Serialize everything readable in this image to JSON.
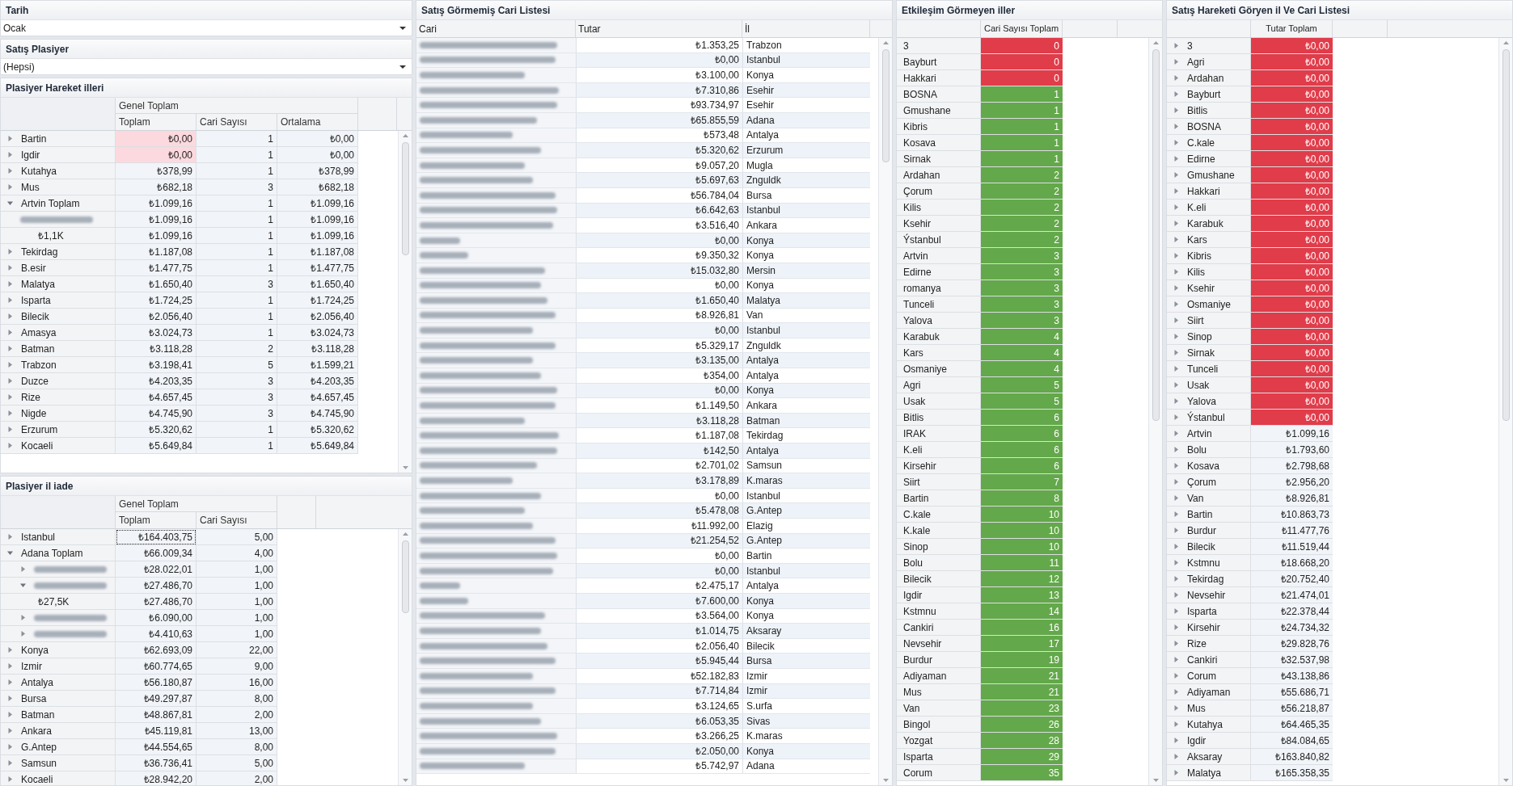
{
  "filters": [
    {
      "title": "Tarih",
      "value": "Ocak"
    },
    {
      "title": "Satış Plasiyer",
      "value": "(Hepsi)"
    }
  ],
  "hareket": {
    "title": "Plasiyer Hareket illeri",
    "group": "Genel Toplam",
    "columns": [
      "Toplam",
      "Cari Sayısı",
      "Ortalama"
    ],
    "rows": [
      {
        "label": "Bartin",
        "expanded": false,
        "flagged": true,
        "values": [
          "₺0,00",
          "1",
          "₺0,00"
        ]
      },
      {
        "label": "Igdir",
        "expanded": false,
        "flagged": true,
        "values": [
          "₺0,00",
          "1",
          "₺0,00"
        ]
      },
      {
        "label": "Kutahya",
        "expanded": false,
        "flagged": false,
        "values": [
          "₺378,99",
          "1",
          "₺378,99"
        ]
      },
      {
        "label": "Mus",
        "expanded": false,
        "flagged": false,
        "values": [
          "₺682,18",
          "3",
          "₺682,18"
        ]
      },
      {
        "label": "Artvin Toplam",
        "expanded": true,
        "flagged": false,
        "values": [
          "₺1.099,16",
          "1",
          "₺1.099,16"
        ],
        "children": [
          {
            "flagged": false,
            "values": [
              "₺1.099,16",
              "1",
              "₺1.099,16"
            ],
            "children": [
              {
                "label": "₺1,1K",
                "flagged": false,
                "values": [
                  "₺1.099,16",
                  "1",
                  "₺1.099,16"
                ]
              }
            ]
          }
        ]
      },
      {
        "label": "Tekirdag",
        "expanded": false,
        "flagged": false,
        "values": [
          "₺1.187,08",
          "1",
          "₺1.187,08"
        ]
      },
      {
        "label": "B.esir",
        "expanded": false,
        "flagged": false,
        "values": [
          "₺1.477,75",
          "1",
          "₺1.477,75"
        ]
      },
      {
        "label": "Malatya",
        "expanded": false,
        "flagged": false,
        "values": [
          "₺1.650,40",
          "3",
          "₺1.650,40"
        ]
      },
      {
        "label": "Isparta",
        "expanded": false,
        "flagged": false,
        "values": [
          "₺1.724,25",
          "1",
          "₺1.724,25"
        ]
      },
      {
        "label": "Bilecik",
        "expanded": false,
        "flagged": false,
        "values": [
          "₺2.056,40",
          "1",
          "₺2.056,40"
        ]
      },
      {
        "label": "Amasya",
        "expanded": false,
        "flagged": false,
        "values": [
          "₺3.024,73",
          "1",
          "₺3.024,73"
        ]
      },
      {
        "label": "Batman",
        "expanded": false,
        "flagged": false,
        "values": [
          "₺3.118,28",
          "2",
          "₺3.118,28"
        ]
      },
      {
        "label": "Trabzon",
        "expanded": false,
        "flagged": false,
        "values": [
          "₺3.198,41",
          "5",
          "₺1.599,21"
        ]
      },
      {
        "label": "Duzce",
        "expanded": false,
        "flagged": false,
        "values": [
          "₺4.203,35",
          "3",
          "₺4.203,35"
        ]
      },
      {
        "label": "Rize",
        "expanded": false,
        "flagged": false,
        "values": [
          "₺4.657,45",
          "3",
          "₺4.657,45"
        ]
      },
      {
        "label": "Nigde",
        "expanded": false,
        "flagged": false,
        "values": [
          "₺4.745,90",
          "3",
          "₺4.745,90"
        ]
      },
      {
        "label": "Erzurum",
        "expanded": false,
        "flagged": false,
        "values": [
          "₺5.320,62",
          "1",
          "₺5.320,62"
        ]
      },
      {
        "label": "Kocaeli",
        "expanded": false,
        "flagged": false,
        "values": [
          "₺5.649,84",
          "1",
          "₺5.649,84"
        ]
      }
    ]
  },
  "iade": {
    "title": "Plasiyer il iade",
    "group": "Genel Toplam",
    "columns": [
      "Toplam",
      "Cari Sayısı"
    ],
    "rows": [
      {
        "label": "Istanbul",
        "expanded": false,
        "focused": true,
        "values": [
          "₺164.403,75",
          "5,00"
        ]
      },
      {
        "label": "Adana Toplam",
        "expanded": true,
        "focused": false,
        "values": [
          "₺66.009,34",
          "4,00"
        ],
        "children": [
          {
            "expanded": false,
            "focused": false,
            "values": [
              "₺28.022,01",
              "1,00"
            ]
          },
          {
            "expanded": true,
            "focused": false,
            "values": [
              "₺27.486,70",
              "1,00"
            ],
            "children": [
              {
                "label": "₺27,5K",
                "focused": false,
                "values": [
                  "₺27.486,70",
                  "1,00"
                ]
              }
            ]
          },
          {
            "expanded": false,
            "focused": false,
            "values": [
              "₺6.090,00",
              "1,00"
            ]
          },
          {
            "expanded": false,
            "focused": false,
            "values": [
              "₺4.410,63",
              "1,00"
            ]
          }
        ]
      },
      {
        "label": "Konya",
        "expanded": false,
        "focused": false,
        "values": [
          "₺62.693,09",
          "22,00"
        ]
      },
      {
        "label": "Izmir",
        "expanded": false,
        "focused": false,
        "values": [
          "₺60.774,65",
          "9,00"
        ]
      },
      {
        "label": "Antalya",
        "expanded": false,
        "focused": false,
        "values": [
          "₺56.180,87",
          "16,00"
        ]
      },
      {
        "label": "Bursa",
        "expanded": false,
        "focused": false,
        "values": [
          "₺49.297,87",
          "8,00"
        ]
      },
      {
        "label": "Batman",
        "expanded": false,
        "focused": false,
        "values": [
          "₺48.867,81",
          "2,00"
        ]
      },
      {
        "label": "Ankara",
        "expanded": false,
        "focused": false,
        "values": [
          "₺45.119,81",
          "13,00"
        ]
      },
      {
        "label": "G.Antep",
        "expanded": false,
        "focused": false,
        "values": [
          "₺44.554,65",
          "8,00"
        ]
      },
      {
        "label": "Samsun",
        "expanded": false,
        "focused": false,
        "values": [
          "₺36.736,41",
          "5,00"
        ]
      },
      {
        "label": "Kocaeli",
        "expanded": false,
        "focused": false,
        "values": [
          "₺28.942,20",
          "2,00"
        ]
      }
    ]
  },
  "cari_list": {
    "title": "Satış Görmemiş Cari Listesi",
    "columns": [
      "Cari",
      "Tutar",
      "İl"
    ],
    "rows": [
      {
        "tutar": "₺1.353,25",
        "il": "Trabzon"
      },
      {
        "tutar": "₺0,00",
        "il": "Istanbul"
      },
      {
        "tutar": "₺3.100,00",
        "il": "Konya"
      },
      {
        "tutar": "₺7.310,86",
        "il": "Esehir"
      },
      {
        "tutar": "₺93.734,97",
        "il": "Esehir"
      },
      {
        "tutar": "₺65.855,59",
        "il": "Adana"
      },
      {
        "tutar": "₺573,48",
        "il": "Antalya"
      },
      {
        "tutar": "₺5.320,62",
        "il": "Erzurum"
      },
      {
        "tutar": "₺9.057,20",
        "il": "Mugla"
      },
      {
        "tutar": "₺5.697,63",
        "il": "Znguldk"
      },
      {
        "tutar": "₺56.784,04",
        "il": "Bursa"
      },
      {
        "tutar": "₺6.642,63",
        "il": "Istanbul"
      },
      {
        "tutar": "₺3.516,40",
        "il": "Ankara"
      },
      {
        "tutar": "₺0,00",
        "il": "Konya"
      },
      {
        "tutar": "₺9.350,32",
        "il": "Konya"
      },
      {
        "tutar": "₺15.032,80",
        "il": "Mersin"
      },
      {
        "tutar": "₺0,00",
        "il": "Konya"
      },
      {
        "tutar": "₺1.650,40",
        "il": "Malatya"
      },
      {
        "tutar": "₺8.926,81",
        "il": "Van"
      },
      {
        "tutar": "₺0,00",
        "il": "Istanbul"
      },
      {
        "tutar": "₺5.329,17",
        "il": "Znguldk"
      },
      {
        "tutar": "₺3.135,00",
        "il": "Antalya"
      },
      {
        "tutar": "₺354,00",
        "il": "Antalya"
      },
      {
        "tutar": "₺0,00",
        "il": "Konya"
      },
      {
        "tutar": "₺1.149,50",
        "il": "Ankara"
      },
      {
        "tutar": "₺3.118,28",
        "il": "Batman"
      },
      {
        "tutar": "₺1.187,08",
        "il": "Tekirdag"
      },
      {
        "tutar": "₺142,50",
        "il": "Antalya"
      },
      {
        "tutar": "₺2.701,02",
        "il": "Samsun"
      },
      {
        "tutar": "₺3.178,89",
        "il": "K.maras"
      },
      {
        "tutar": "₺0,00",
        "il": "Istanbul"
      },
      {
        "tutar": "₺5.478,08",
        "il": "G.Antep"
      },
      {
        "tutar": "₺11.992,00",
        "il": "Elazig"
      },
      {
        "tutar": "₺21.254,52",
        "il": "G.Antep"
      },
      {
        "tutar": "₺0,00",
        "il": "Bartin"
      },
      {
        "tutar": "₺0,00",
        "il": "Istanbul"
      },
      {
        "tutar": "₺2.475,17",
        "il": "Antalya"
      },
      {
        "tutar": "₺7.600,00",
        "il": "Konya"
      },
      {
        "tutar": "₺3.564,00",
        "il": "Konya"
      },
      {
        "tutar": "₺1.014,75",
        "il": "Aksaray"
      },
      {
        "tutar": "₺2.056,40",
        "il": "Bilecik"
      },
      {
        "tutar": "₺5.945,44",
        "il": "Bursa"
      },
      {
        "tutar": "₺52.182,83",
        "il": "Izmir"
      },
      {
        "tutar": "₺7.714,84",
        "il": "Izmir"
      },
      {
        "tutar": "₺3.124,65",
        "il": "S.urfa"
      },
      {
        "tutar": "₺6.053,35",
        "il": "Sivas"
      },
      {
        "tutar": "₺3.266,25",
        "il": "K.maras"
      },
      {
        "tutar": "₺2.050,00",
        "il": "Konya"
      },
      {
        "tutar": "₺5.742,97",
        "il": "Adana"
      }
    ]
  },
  "etkilesim": {
    "title": "Etkileşim Görmeyen iller",
    "column": "Cari Sayısı Toplam",
    "rows": [
      {
        "label": "3",
        "value": "0",
        "color": "#e03c4a"
      },
      {
        "label": "Bayburt",
        "value": "0",
        "color": "#e03c4a"
      },
      {
        "label": "Hakkari",
        "value": "0",
        "color": "#e03c4a"
      },
      {
        "label": "BOSNA",
        "value": "1",
        "color": "#63a84a"
      },
      {
        "label": "Gmushane",
        "value": "1",
        "color": "#63a84a"
      },
      {
        "label": "Kibris",
        "value": "1",
        "color": "#63a84a"
      },
      {
        "label": "Kosava",
        "value": "1",
        "color": "#63a84a"
      },
      {
        "label": "Sirnak",
        "value": "1",
        "color": "#63a84a"
      },
      {
        "label": "Ardahan",
        "value": "2",
        "color": "#63a84a"
      },
      {
        "label": "Çorum",
        "value": "2",
        "color": "#63a84a"
      },
      {
        "label": "Kilis",
        "value": "2",
        "color": "#63a84a"
      },
      {
        "label": "Ksehir",
        "value": "2",
        "color": "#63a84a"
      },
      {
        "label": "Ýstanbul",
        "value": "2",
        "color": "#63a84a"
      },
      {
        "label": "Artvin",
        "value": "3",
        "color": "#63a84a"
      },
      {
        "label": "Edirne",
        "value": "3",
        "color": "#63a84a"
      },
      {
        "label": "romanya",
        "value": "3",
        "color": "#63a84a"
      },
      {
        "label": "Tunceli",
        "value": "3",
        "color": "#63a84a"
      },
      {
        "label": "Yalova",
        "value": "3",
        "color": "#63a84a"
      },
      {
        "label": "Karabuk",
        "value": "4",
        "color": "#63a84a"
      },
      {
        "label": "Kars",
        "value": "4",
        "color": "#63a84a"
      },
      {
        "label": "Osmaniye",
        "value": "4",
        "color": "#63a84a"
      },
      {
        "label": "Agri",
        "value": "5",
        "color": "#63a84a"
      },
      {
        "label": "Usak",
        "value": "5",
        "color": "#63a84a"
      },
      {
        "label": "Bitlis",
        "value": "6",
        "color": "#63a84a"
      },
      {
        "label": "IRAK",
        "value": "6",
        "color": "#63a84a"
      },
      {
        "label": "K.eli",
        "value": "6",
        "color": "#63a84a"
      },
      {
        "label": "Kirsehir",
        "value": "6",
        "color": "#63a84a"
      },
      {
        "label": "Siirt",
        "value": "7",
        "color": "#63a84a"
      },
      {
        "label": "Bartin",
        "value": "8",
        "color": "#63a84a"
      },
      {
        "label": "C.kale",
        "value": "10",
        "color": "#63a84a"
      },
      {
        "label": "K.kale",
        "value": "10",
        "color": "#63a84a"
      },
      {
        "label": "Sinop",
        "value": "10",
        "color": "#63a84a"
      },
      {
        "label": "Bolu",
        "value": "11",
        "color": "#63a84a"
      },
      {
        "label": "Bilecik",
        "value": "12",
        "color": "#63a84a"
      },
      {
        "label": "Igdir",
        "value": "13",
        "color": "#63a84a"
      },
      {
        "label": "Kstmnu",
        "value": "14",
        "color": "#63a84a"
      },
      {
        "label": "Cankiri",
        "value": "16",
        "color": "#63a84a"
      },
      {
        "label": "Nevsehir",
        "value": "17",
        "color": "#63a84a"
      },
      {
        "label": "Burdur",
        "value": "19",
        "color": "#63a84a"
      },
      {
        "label": "Adiyaman",
        "value": "21",
        "color": "#63a84a"
      },
      {
        "label": "Mus",
        "value": "21",
        "color": "#63a84a"
      },
      {
        "label": "Van",
        "value": "23",
        "color": "#63a84a"
      },
      {
        "label": "Bingol",
        "value": "26",
        "color": "#63a84a"
      },
      {
        "label": "Yozgat",
        "value": "28",
        "color": "#63a84a"
      },
      {
        "label": "Isparta",
        "value": "29",
        "color": "#63a84a"
      },
      {
        "label": "Corum",
        "value": "35",
        "color": "#63a84a"
      }
    ]
  },
  "hareket_goren": {
    "title": "Satış Hareketi Göryen il Ve Cari Listesi",
    "column": "Tutar Toplam",
    "rows": [
      {
        "label": "3",
        "value": "₺0,00",
        "flagged": true,
        "expanded": false
      },
      {
        "label": "Agri",
        "value": "₺0,00",
        "flagged": true,
        "expanded": false
      },
      {
        "label": "Ardahan",
        "value": "₺0,00",
        "flagged": true,
        "expanded": false
      },
      {
        "label": "Bayburt",
        "value": "₺0,00",
        "flagged": true,
        "expanded": false
      },
      {
        "label": "Bitlis",
        "value": "₺0,00",
        "flagged": true,
        "expanded": false
      },
      {
        "label": "BOSNA",
        "value": "₺0,00",
        "flagged": true,
        "expanded": false
      },
      {
        "label": "C.kale",
        "value": "₺0,00",
        "flagged": true,
        "expanded": false
      },
      {
        "label": "Edirne",
        "value": "₺0,00",
        "flagged": true,
        "expanded": false
      },
      {
        "label": "Gmushane",
        "value": "₺0,00",
        "flagged": true,
        "expanded": false
      },
      {
        "label": "Hakkari",
        "value": "₺0,00",
        "flagged": true,
        "expanded": false
      },
      {
        "label": "K.eli",
        "value": "₺0,00",
        "flagged": true,
        "expanded": false
      },
      {
        "label": "Karabuk",
        "value": "₺0,00",
        "flagged": true,
        "expanded": false
      },
      {
        "label": "Kars",
        "value": "₺0,00",
        "flagged": true,
        "expanded": false
      },
      {
        "label": "Kibris",
        "value": "₺0,00",
        "flagged": true,
        "expanded": false
      },
      {
        "label": "Kilis",
        "value": "₺0,00",
        "flagged": true,
        "expanded": false
      },
      {
        "label": "Ksehir",
        "value": "₺0,00",
        "flagged": true,
        "expanded": false
      },
      {
        "label": "Osmaniye",
        "value": "₺0,00",
        "flagged": true,
        "expanded": false
      },
      {
        "label": "Siirt",
        "value": "₺0,00",
        "flagged": true,
        "expanded": false
      },
      {
        "label": "Sinop",
        "value": "₺0,00",
        "flagged": true,
        "expanded": false
      },
      {
        "label": "Sirnak",
        "value": "₺0,00",
        "flagged": true,
        "expanded": false
      },
      {
        "label": "Tunceli",
        "value": "₺0,00",
        "flagged": true,
        "expanded": false
      },
      {
        "label": "Usak",
        "value": "₺0,00",
        "flagged": true,
        "expanded": false
      },
      {
        "label": "Yalova",
        "value": "₺0,00",
        "flagged": true,
        "expanded": false
      },
      {
        "label": "Ýstanbul",
        "value": "₺0,00",
        "flagged": true,
        "expanded": false
      },
      {
        "label": "Artvin",
        "value": "₺1.099,16",
        "flagged": false,
        "expanded": false
      },
      {
        "label": "Bolu",
        "value": "₺1.793,60",
        "flagged": false,
        "expanded": false
      },
      {
        "label": "Kosava",
        "value": "₺2.798,68",
        "flagged": false,
        "expanded": false
      },
      {
        "label": "Çorum",
        "value": "₺2.956,20",
        "flagged": false,
        "expanded": false
      },
      {
        "label": "Van",
        "value": "₺8.926,81",
        "flagged": false,
        "expanded": false
      },
      {
        "label": "Bartin",
        "value": "₺10.863,73",
        "flagged": false,
        "expanded": false
      },
      {
        "label": "Burdur",
        "value": "₺11.477,76",
        "flagged": false,
        "expanded": false
      },
      {
        "label": "Bilecik",
        "value": "₺11.519,44",
        "flagged": false,
        "expanded": false
      },
      {
        "label": "Kstmnu",
        "value": "₺18.668,20",
        "flagged": false,
        "expanded": false
      },
      {
        "label": "Tekirdag",
        "value": "₺20.752,40",
        "flagged": false,
        "expanded": false
      },
      {
        "label": "Nevsehir",
        "value": "₺21.474,01",
        "flagged": false,
        "expanded": false
      },
      {
        "label": "Isparta",
        "value": "₺22.378,44",
        "flagged": false,
        "expanded": false
      },
      {
        "label": "Kirsehir",
        "value": "₺24.734,32",
        "flagged": false,
        "expanded": false
      },
      {
        "label": "Rize",
        "value": "₺29.828,76",
        "flagged": false,
        "expanded": false
      },
      {
        "label": "Cankiri",
        "value": "₺32.537,98",
        "flagged": false,
        "expanded": false
      },
      {
        "label": "Corum",
        "value": "₺43.138,86",
        "flagged": false,
        "expanded": false
      },
      {
        "label": "Adiyaman",
        "value": "₺55.686,71",
        "flagged": false,
        "expanded": false
      },
      {
        "label": "Mus",
        "value": "₺56.218,87",
        "flagged": false,
        "expanded": false
      },
      {
        "label": "Kutahya",
        "value": "₺64.465,35",
        "flagged": false,
        "expanded": false
      },
      {
        "label": "Igdir",
        "value": "₺84.084,65",
        "flagged": false,
        "expanded": false
      },
      {
        "label": "Aksaray",
        "value": "₺163.840,82",
        "flagged": false,
        "expanded": false
      },
      {
        "label": "Malatya",
        "value": "₺165.358,35",
        "flagged": false,
        "expanded": false
      }
    ]
  }
}
